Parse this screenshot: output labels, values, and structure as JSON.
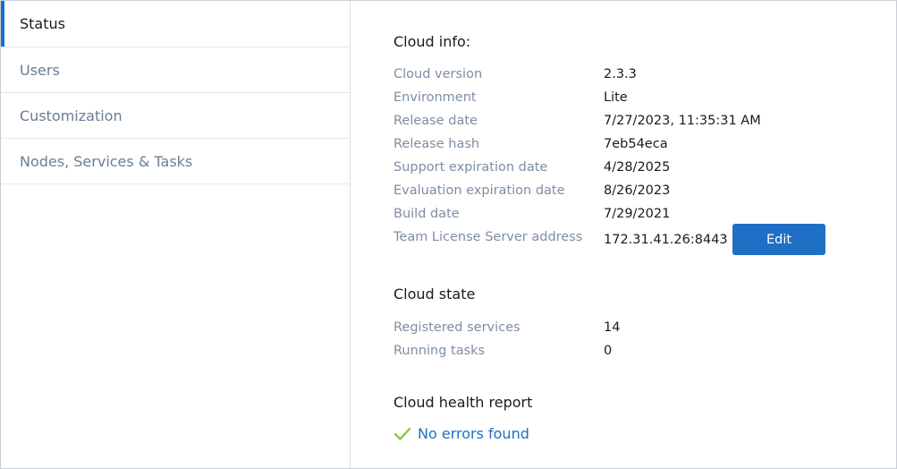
{
  "sidebar": {
    "items": [
      {
        "label": "Status"
      },
      {
        "label": "Users"
      },
      {
        "label": "Customization"
      },
      {
        "label": "Nodes, Services & Tasks"
      }
    ]
  },
  "cloud_info": {
    "title": "Cloud info:",
    "rows": [
      {
        "label": "Cloud version",
        "value": "2.3.3"
      },
      {
        "label": "Environment",
        "value": "Lite"
      },
      {
        "label": "Release date",
        "value": "7/27/2023, 11:35:31 AM"
      },
      {
        "label": "Release hash",
        "value": "7eb54eca"
      },
      {
        "label": "Support expiration date",
        "value": "4/28/2025"
      },
      {
        "label": "Evaluation expiration date",
        "value": "8/26/2023"
      },
      {
        "label": "Build date",
        "value": "7/29/2021"
      },
      {
        "label": "Team License Server address",
        "value": "172.31.41.26:8443"
      }
    ],
    "edit_label": "Edit"
  },
  "cloud_state": {
    "title": "Cloud state",
    "rows": [
      {
        "label": "Registered services",
        "value": "14"
      },
      {
        "label": "Running tasks",
        "value": "0"
      }
    ]
  },
  "health": {
    "title": "Cloud health report",
    "status": "No errors found",
    "status_icon": "check-icon"
  },
  "colors": {
    "accent": "#1f6fc5",
    "check": "#8cc63f",
    "label": "#7d8ea3"
  }
}
